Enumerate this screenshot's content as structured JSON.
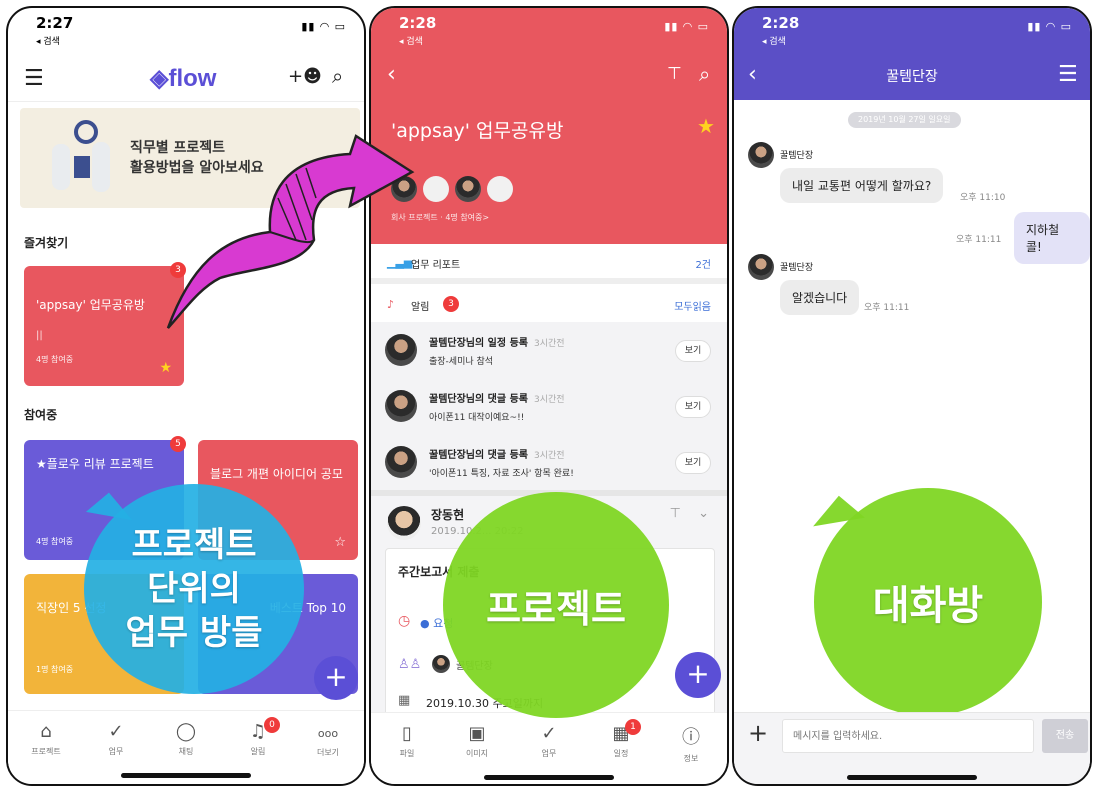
{
  "phone1": {
    "status": {
      "time": "2:27",
      "back": "◂ 검색"
    },
    "header": {
      "logo": "flow"
    },
    "banner": {
      "line1": "직무별 프로젝트",
      "line2": "활용방법을 알아보세요"
    },
    "favorites": {
      "title": "즐겨찾기",
      "card": {
        "name": "'appsay' 업무공유방",
        "members": "4명 참여중",
        "badge": "3",
        "color": "#e8575f"
      }
    },
    "participating": {
      "title": "참여중",
      "cards": [
        {
          "name": "★플로우 리뷰 프로젝트",
          "members": "4명 참여중",
          "badge": "5",
          "color": "#6a5bd8"
        },
        {
          "name": "블로그 개편 아이디어 공모",
          "members": "",
          "badge": "",
          "color": "#e8575f"
        },
        {
          "name": "직장인 5 선정",
          "members": "1명 참여중",
          "badge": "",
          "color": "#f2b43a"
        },
        {
          "name": "베스트 Top 10",
          "members": "",
          "badge": "",
          "color": "#6a5bd8"
        }
      ]
    },
    "overlay": {
      "line1": "프로젝트",
      "line2": "단위의",
      "line3": "업무 방들"
    },
    "tabs": [
      {
        "label": "프로젝트",
        "icon": "home-icon",
        "glyph": "⌂"
      },
      {
        "label": "업무",
        "icon": "check-icon",
        "glyph": "✓"
      },
      {
        "label": "채팅",
        "icon": "chat-icon",
        "glyph": "◯"
      },
      {
        "label": "알림",
        "icon": "bell-icon",
        "glyph": "♫",
        "badge": "0"
      },
      {
        "label": "더보기",
        "icon": "more-icon",
        "glyph": "ooo"
      }
    ]
  },
  "phone2": {
    "status": {
      "time": "2:28",
      "back": "◂ 검색"
    },
    "title": "'appsay' 업무공유방",
    "subtitle": "회사 프로젝트 · 4명 참여중>",
    "report": {
      "label": "업무 리포트",
      "count": "2건"
    },
    "alerts": {
      "label": "알림",
      "badge": "3",
      "action": "모두읽음"
    },
    "notifications": [
      {
        "title": "꿀템단장님의 일정 등록",
        "time": "3시간전",
        "sub": "출장-세미나 참석",
        "btn": "보기"
      },
      {
        "title": "꿀템단장님의 댓글 등록",
        "time": "3시간전",
        "sub": "아이폰11 대작이예요~!!",
        "btn": "보기"
      },
      {
        "title": "꿀템단장님의 댓글 등록",
        "time": "3시간전",
        "sub": "'아이폰11 특징, 자료 조사' 항목 완료!",
        "btn": "보기"
      }
    ],
    "post": {
      "author": "장동현",
      "date": "2019.10.2... 20:22",
      "heading": "주간보고서 제출",
      "status": "요청",
      "assignee": "꿀템단장",
      "due": "2019.10.30 주고일까지"
    },
    "overlay": "프로젝트",
    "tabs": [
      {
        "label": "파일",
        "icon": "file-icon",
        "glyph": "▯"
      },
      {
        "label": "이미지",
        "icon": "image-icon",
        "glyph": "▣"
      },
      {
        "label": "업무",
        "icon": "check-icon",
        "glyph": "✓"
      },
      {
        "label": "일정",
        "icon": "calendar-icon",
        "glyph": "▦",
        "badge": "1"
      },
      {
        "label": "정보",
        "icon": "info-icon",
        "glyph": "ⓘ"
      }
    ]
  },
  "phone3": {
    "status": {
      "time": "2:28",
      "back": "◂ 검색"
    },
    "title": "꿀템단장",
    "date_chip": "2019년 10월 27일 일요일",
    "messages": [
      {
        "sender": "꿀템단장",
        "text": "내일 교통편 어떻게 할까요?",
        "time": "오후 11:10",
        "mine": false
      },
      {
        "sender": "",
        "text": "지하철 콜!",
        "time": "오후 11:11",
        "mine": true
      },
      {
        "sender": "꿀템단장",
        "text": "알겠습니다",
        "time": "오후 11:11",
        "mine": false
      }
    ],
    "overlay": "대화방",
    "input": {
      "placeholder": "메시지를 입력하세요.",
      "send": "전송"
    }
  }
}
